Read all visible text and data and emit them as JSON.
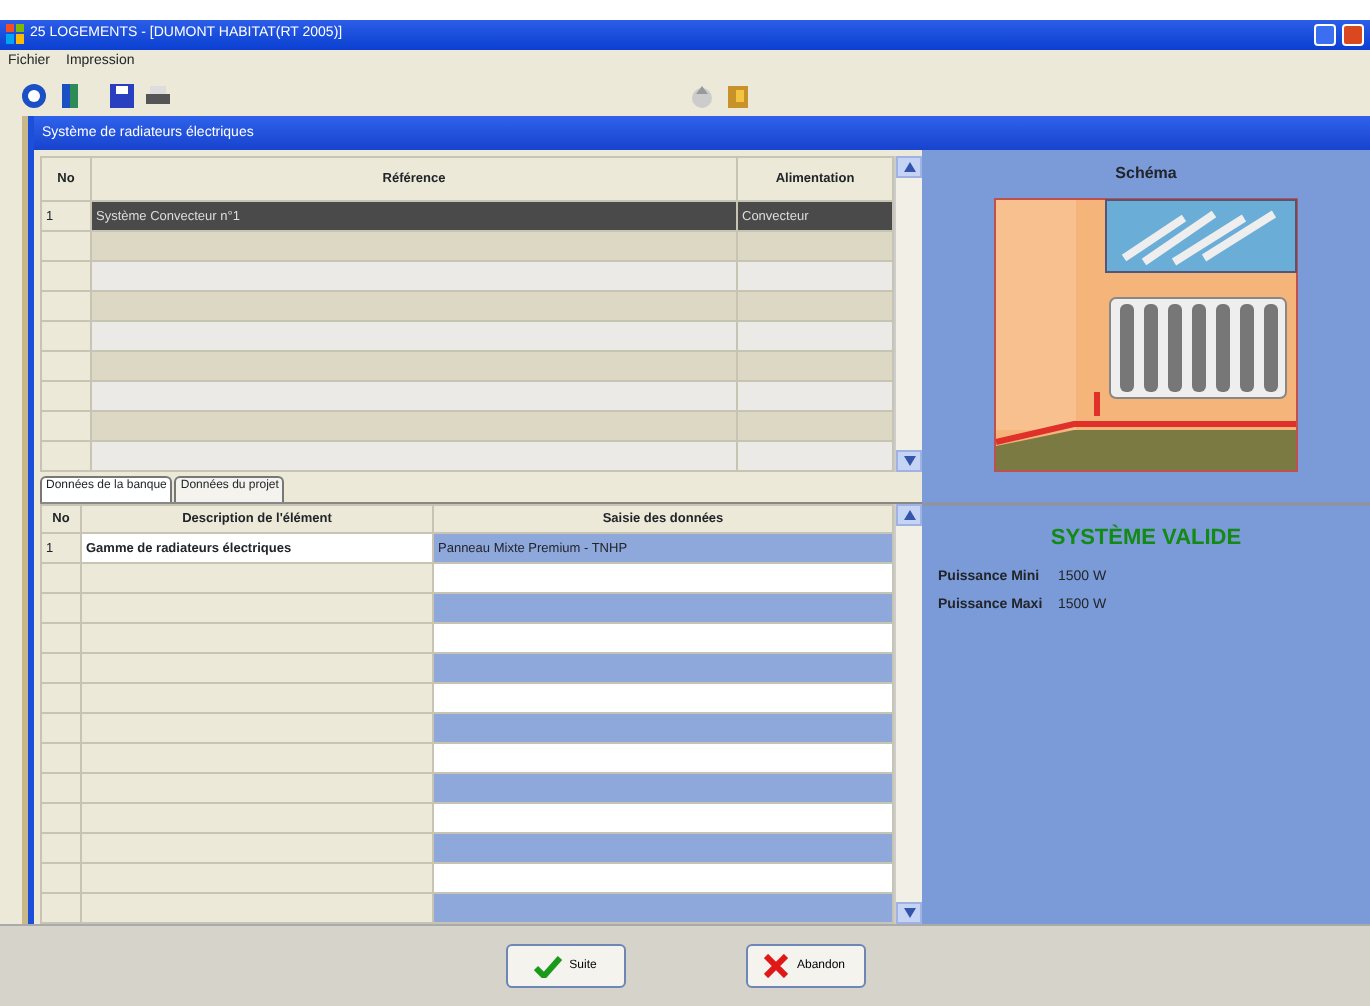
{
  "window": {
    "title": "25 LOGEMENTS - [DUMONT HABITAT(RT 2005)]"
  },
  "menu": [
    "Fichier",
    "Impression"
  ],
  "panel": {
    "title": "Système de radiateurs électriques"
  },
  "systems_table": {
    "columns": [
      "No",
      "Référence",
      "Alimentation"
    ],
    "rows": [
      {
        "cells": [
          "1",
          "Système Convecteur n°1",
          "Convecteur"
        ],
        "selected": true
      }
    ]
  },
  "tabs": [
    {
      "label": "Données de la banque",
      "selected": true
    },
    {
      "label": "Données du projet",
      "selected": false
    }
  ],
  "data_table": {
    "columns": [
      "No",
      "Description de l'élément",
      "Saisie des données"
    ],
    "rows": [
      {
        "cells": [
          "1",
          "Gamme de radiateurs électriques",
          "Panneau Mixte Premium - TNHP"
        ]
      }
    ]
  },
  "schema": {
    "title": "Schéma",
    "status": "SYSTÈME VALIDE",
    "readings": [
      {
        "label": "Puissance Mini",
        "value": "1500 W"
      },
      {
        "label": "Puissance Maxi",
        "value": "1500 W"
      }
    ]
  },
  "buttons": [
    {
      "label": "Suite",
      "kind": "ok"
    },
    {
      "label": "Abandon",
      "kind": "cancel"
    }
  ]
}
